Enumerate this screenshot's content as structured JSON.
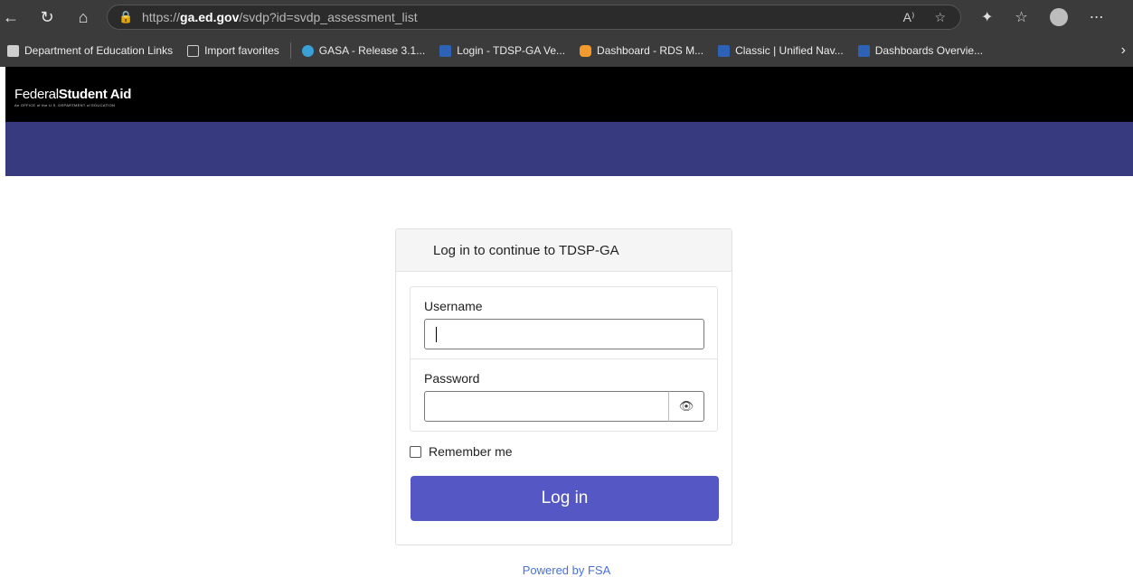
{
  "browser": {
    "url_prefix": "https://",
    "url_host": "ga.ed.gov",
    "url_path": "/svdp?id=svdp_assessment_list",
    "read_aloud": "A⁾",
    "bookmarks": [
      {
        "label": "Department of Education Links",
        "icon": "folder-icon"
      },
      {
        "label": "Import favorites",
        "icon": "import-icon"
      },
      {
        "label": "GASA - Release 3.1...",
        "icon": "gasa-icon"
      },
      {
        "label": "Login - TDSP-GA Ve...",
        "icon": "fsa-icon"
      },
      {
        "label": "Dashboard - RDS M...",
        "icon": "hexagon-icon"
      },
      {
        "label": "Classic | Unified Nav...",
        "icon": "fsa-icon"
      },
      {
        "label": "Dashboards Overvie...",
        "icon": "fsa-icon"
      }
    ]
  },
  "header": {
    "logo_text_1": "Federal",
    "logo_text_2": "Student Aid",
    "logo_sub": "An OFFICE of the U.S. DEPARTMENT of EDUCATION"
  },
  "login": {
    "title": "Log in to continue to TDSP-GA",
    "username_label": "Username",
    "username_value": "",
    "password_label": "Password",
    "password_value": "",
    "remember_label": "Remember me",
    "submit_label": "Log in",
    "powered_by": "Powered by FSA"
  },
  "colors": {
    "band": "#373a7e",
    "button": "#5457c4",
    "link": "#4a6fd8"
  }
}
